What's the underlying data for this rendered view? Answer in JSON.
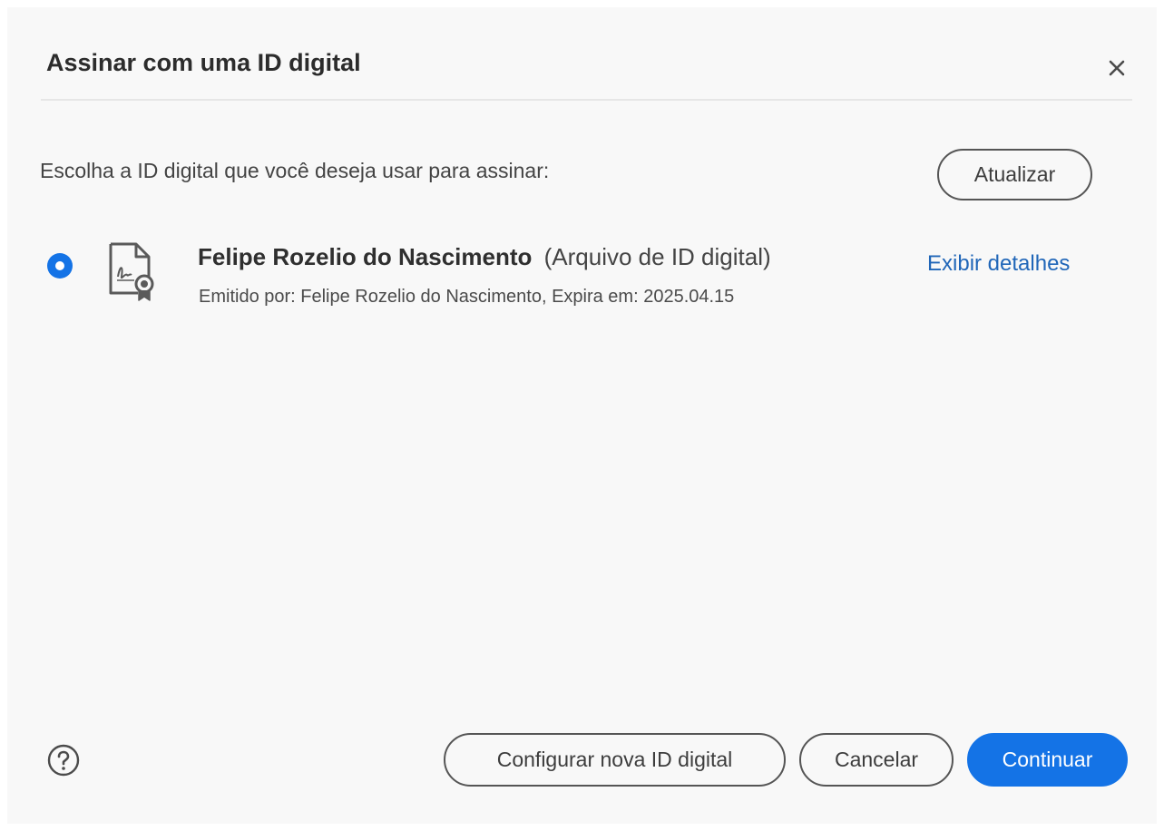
{
  "dialog": {
    "title": "Assinar com uma ID digital",
    "close_icon": "close-icon"
  },
  "main": {
    "prompt": "Escolha a ID digital que você deseja usar para assinar:",
    "refresh_label": "Atualizar",
    "ids": [
      {
        "selected": true,
        "icon": "certificate-file-icon",
        "name": "Felipe Rozelio do Nascimento",
        "type": "(Arquivo de ID digital)",
        "issued": "Emitido por: Felipe Rozelio do Nascimento, Expira em: 2025.04.15",
        "details_label": "Exibir detalhes"
      }
    ]
  },
  "footer": {
    "help_icon": "help-icon",
    "configure_label": "Configurar nova ID digital",
    "cancel_label": "Cancelar",
    "continue_label": "Continuar"
  },
  "colors": {
    "accent": "#1473e6",
    "link": "#2066b8",
    "dialog_bg": "#f8f8f8"
  }
}
